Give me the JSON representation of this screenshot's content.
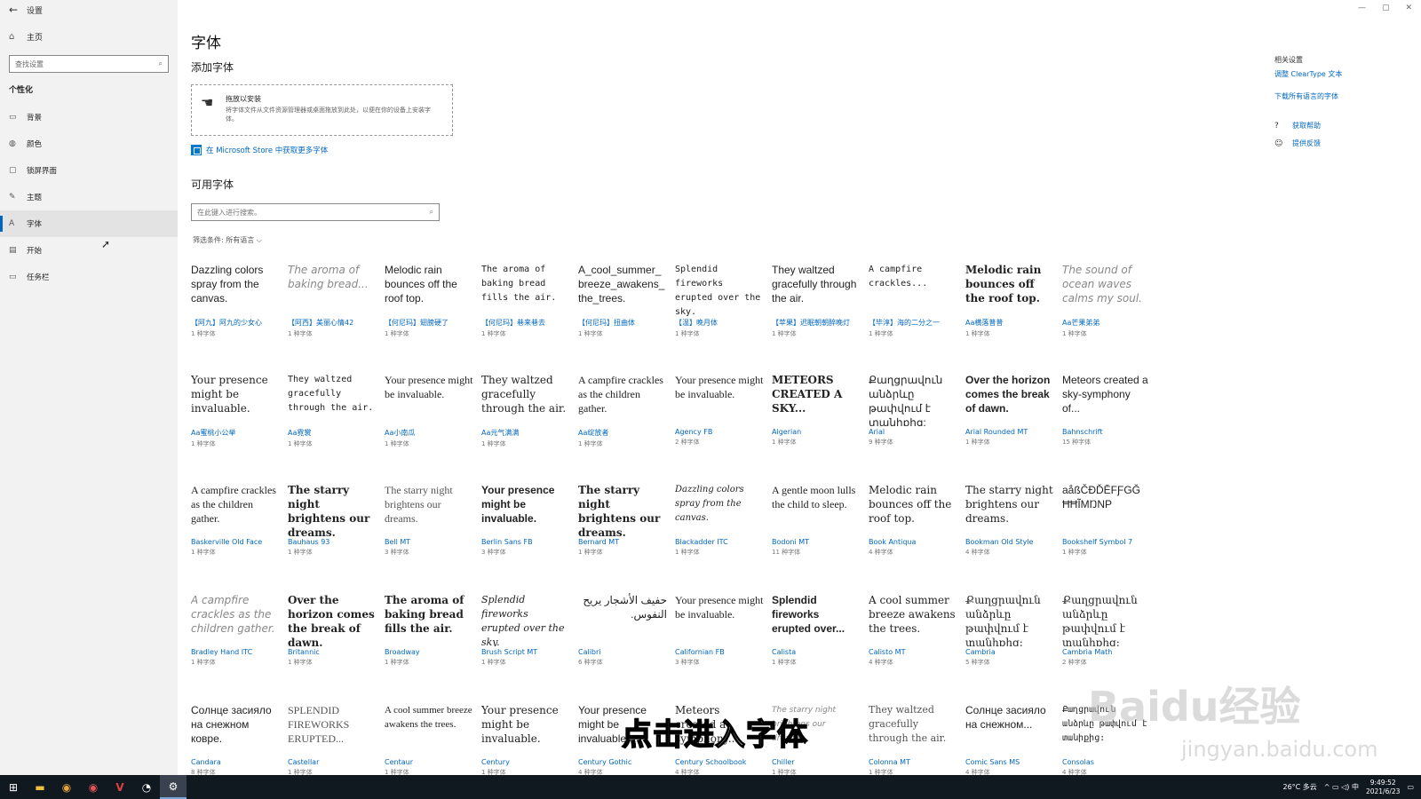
{
  "window": {
    "title": "设置",
    "controls": [
      "—",
      "▢",
      "✕"
    ]
  },
  "sidebar": {
    "back": "←",
    "home": {
      "icon": "⌂",
      "label": "主页"
    },
    "search": {
      "placeholder": "查找设置",
      "icon": "⌕"
    },
    "section": "个性化",
    "items": [
      {
        "icon": "▭",
        "label": "背景"
      },
      {
        "icon": "◍",
        "label": "颜色"
      },
      {
        "icon": "▢",
        "label": "锁屏界面"
      },
      {
        "icon": "✎",
        "label": "主题"
      },
      {
        "icon": "A",
        "label": "字体"
      },
      {
        "icon": "▤",
        "label": "开始"
      },
      {
        "icon": "▭",
        "label": "任务栏"
      }
    ]
  },
  "main": {
    "title": "字体",
    "add_heading": "添加字体",
    "dropzone": {
      "icon": "☚",
      "title": "拖放以安装",
      "desc": "将字体文件从文件资源管理器或桌面拖放到此处，以便在你的设备上安装字体。"
    },
    "store_link": "在 Microsoft Store 中获取更多字体",
    "available_heading": "可用字体",
    "search": {
      "placeholder": "在此键入进行搜索。",
      "icon": "⌕"
    },
    "filter": {
      "label": "筛选条件: 所有语言",
      "chevron": "⌵"
    }
  },
  "fonts": [
    [
      {
        "sample": "Dazzling colors spray from the canvas.",
        "name": "【阿九】阿九的少女心",
        "count": "1 种字体"
      },
      {
        "sample": "The aroma of baking bread...",
        "name": "【阿西】美丽心情42",
        "count": "1 种字体"
      },
      {
        "sample": "Melodic rain bounces off the roof top.",
        "name": "【何尼玛】翅膀硬了",
        "count": "1 种字体"
      },
      {
        "sample": "The aroma of baking bread fills the air.",
        "name": "【何尼玛】巷来巷去",
        "count": "1 种字体"
      },
      {
        "sample": "A_cool_summer_ breeze_awakens_ the_trees.",
        "name": "【何尼玛】扭曲体",
        "count": "1 种字体"
      },
      {
        "sample": "Splendid fireworks erupted over the sky.",
        "name": "【温】晚月体",
        "count": "1 种字体"
      },
      {
        "sample": "They waltzed gracefully through the air.",
        "name": "【苹果】迟眠朝朝醉晚灯",
        "count": "1 种字体"
      },
      {
        "sample": "A campfire crackles...",
        "name": "【毕淳】海的二分之一",
        "count": "1 种字体"
      },
      {
        "sample": "Melodic rain bounces off the roof top.",
        "name": "Aa横落普普",
        "count": "1 种字体"
      },
      {
        "sample": "The sound of ocean waves calms my soul.",
        "name": "Aa芒果弟弟",
        "count": "1 种字体"
      }
    ],
    [
      {
        "sample": "Your presence might be invaluable.",
        "name": "Aa蜜桃小公举",
        "count": "1 种字体"
      },
      {
        "sample": "They waltzed gracefully through the air.",
        "name": "Aa霓裳",
        "count": "1 种字体"
      },
      {
        "sample": "Your presence might be invaluable.",
        "name": "Aa小南瓜",
        "count": "1 种字体"
      },
      {
        "sample": "They waltzed gracefully through the air.",
        "name": "Aa元气满满",
        "count": "1 种字体"
      },
      {
        "sample": "A campfire crackles as the children gather.",
        "name": "Aa绽放者",
        "count": "1 种字体"
      },
      {
        "sample": "Your presence might be invaluable.",
        "name": "Agency FB",
        "count": "2 种字体"
      },
      {
        "sample": "METEORS CREATED A SKY...",
        "name": "Algerian",
        "count": "1 种字体"
      },
      {
        "sample": "Քաղցրավուն անձրևը թափվում է տանիքից:",
        "name": "Arial",
        "count": "9 种字体"
      },
      {
        "sample": "Over the horizon comes the break of dawn.",
        "name": "Arial Rounded MT",
        "count": "1 种字体"
      },
      {
        "sample": "Meteors created a sky-symphony of...",
        "name": "Bahnschrift",
        "count": "15 种字体"
      }
    ],
    [
      {
        "sample": "A campfire crackles as the children gather.",
        "name": "Baskerville Old Face",
        "count": "1 种字体"
      },
      {
        "sample": "The starry night brightens our dreams.",
        "name": "Bauhaus 93",
        "count": "1 种字体"
      },
      {
        "sample": "The starry night brightens our dreams.",
        "name": "Bell MT",
        "count": "3 种字体"
      },
      {
        "sample": "Your presence might be invaluable.",
        "name": "Berlin Sans FB",
        "count": "3 种字体"
      },
      {
        "sample": "The starry night brightens our dreams.",
        "name": "Bernard MT",
        "count": "1 种字体"
      },
      {
        "sample": "Dazzling colors spray from the canvas.",
        "name": "Blackadder ITC",
        "count": "1 种字体"
      },
      {
        "sample": "A gentle moon lulls the child to sleep.",
        "name": "Bodoni MT",
        "count": "11 种字体"
      },
      {
        "sample": "Melodic rain bounces off the roof top.",
        "name": "Book Antiqua",
        "count": "4 种字体"
      },
      {
        "sample": "The starry night brightens our dreams.",
        "name": "Bookman Old Style",
        "count": "4 种字体"
      },
      {
        "sample": "aåßČĐĎĒFƑGĞ ĦĦĨMŊNP",
        "name": "Bookshelf Symbol 7",
        "count": "1 种字体"
      }
    ],
    [
      {
        "sample": "A campfire crackles as the children gather.",
        "name": "Bradley Hand ITC",
        "count": "1 种字体"
      },
      {
        "sample": "Over the horizon comes the break of dawn.",
        "name": "Britannic",
        "count": "1 种字体"
      },
      {
        "sample": "The aroma of baking bread fills the air.",
        "name": "Broadway",
        "count": "1 种字体"
      },
      {
        "sample": "Splendid fireworks erupted over the sky.",
        "name": "Brush Script MT",
        "count": "1 种字体"
      },
      {
        "sample": "حفيف الأشجار يريح النفوس.",
        "name": "Calibri",
        "count": "6 种字体"
      },
      {
        "sample": "Your presence might be invaluable.",
        "name": "Californian FB",
        "count": "3 种字体"
      },
      {
        "sample": "Splendid fireworks erupted over...",
        "name": "Calista",
        "count": "1 种字体"
      },
      {
        "sample": "A cool summer breeze awakens the trees.",
        "name": "Calisto MT",
        "count": "4 种字体"
      },
      {
        "sample": "Քաղցրավուն անձրևը թափվում է տանիքից:",
        "name": "Cambria",
        "count": "5 种字体"
      },
      {
        "sample": "Քաղցրավուն անձրևը թափվում է տանիքից:",
        "name": "Cambria Math",
        "count": "2 种字体"
      }
    ],
    [
      {
        "sample": "Солнце засияло на снежном ковре.",
        "name": "Candara",
        "count": "8 种字体"
      },
      {
        "sample": "SPLENDID FIREWORKS ERUPTED...",
        "name": "Castellar",
        "count": "1 种字体"
      },
      {
        "sample": "A cool summer breeze awakens the trees.",
        "name": "Centaur",
        "count": "1 种字体"
      },
      {
        "sample": "Your presence might be invaluable.",
        "name": "Century",
        "count": "1 种字体"
      },
      {
        "sample": "Your presence might be invaluable.",
        "name": "Century Gothic",
        "count": "4 种字体"
      },
      {
        "sample": "Meteors created a symphony...",
        "name": "Century Schoolbook",
        "count": "4 种字体"
      },
      {
        "sample": "The starry night brightens our dreams.",
        "name": "Chiller",
        "count": "1 种字体"
      },
      {
        "sample": "They waltzed gracefully through the air.",
        "name": "Colonna MT",
        "count": "1 种字体"
      },
      {
        "sample": "Солнце засияло на снежном...",
        "name": "Comic Sans MS",
        "count": "4 种字体"
      },
      {
        "sample": "Քաղցրավուն անձրևը թափվում է տանիքից:",
        "name": "Consolas",
        "count": "4 种字体"
      }
    ]
  ],
  "related": {
    "title": "相关设置",
    "links": [
      "调整 ClearType 文本",
      "下载所有语言的字体"
    ],
    "help": [
      {
        "icon": "?",
        "label": "获取帮助"
      },
      {
        "icon": "☺",
        "label": "提供反馈"
      }
    ]
  },
  "overlay": {
    "subtitle": "点击进入字体",
    "watermark": "Baidu经验",
    "watermark_sub": "jingyan.baidu.com"
  },
  "taskbar": {
    "start": "⊞",
    "apps": [
      "▬",
      "◉",
      "◉",
      "V",
      "◔",
      "⚙"
    ],
    "weather": "26°C 多云",
    "tray": "^ ▭ ◁) 中",
    "time": "9:49:52",
    "date": "2021/6/23"
  },
  "colors": {
    "accent": "#0067c0",
    "sidebar_bg": "#f2f2f2",
    "taskbar_bg": "#101820"
  }
}
